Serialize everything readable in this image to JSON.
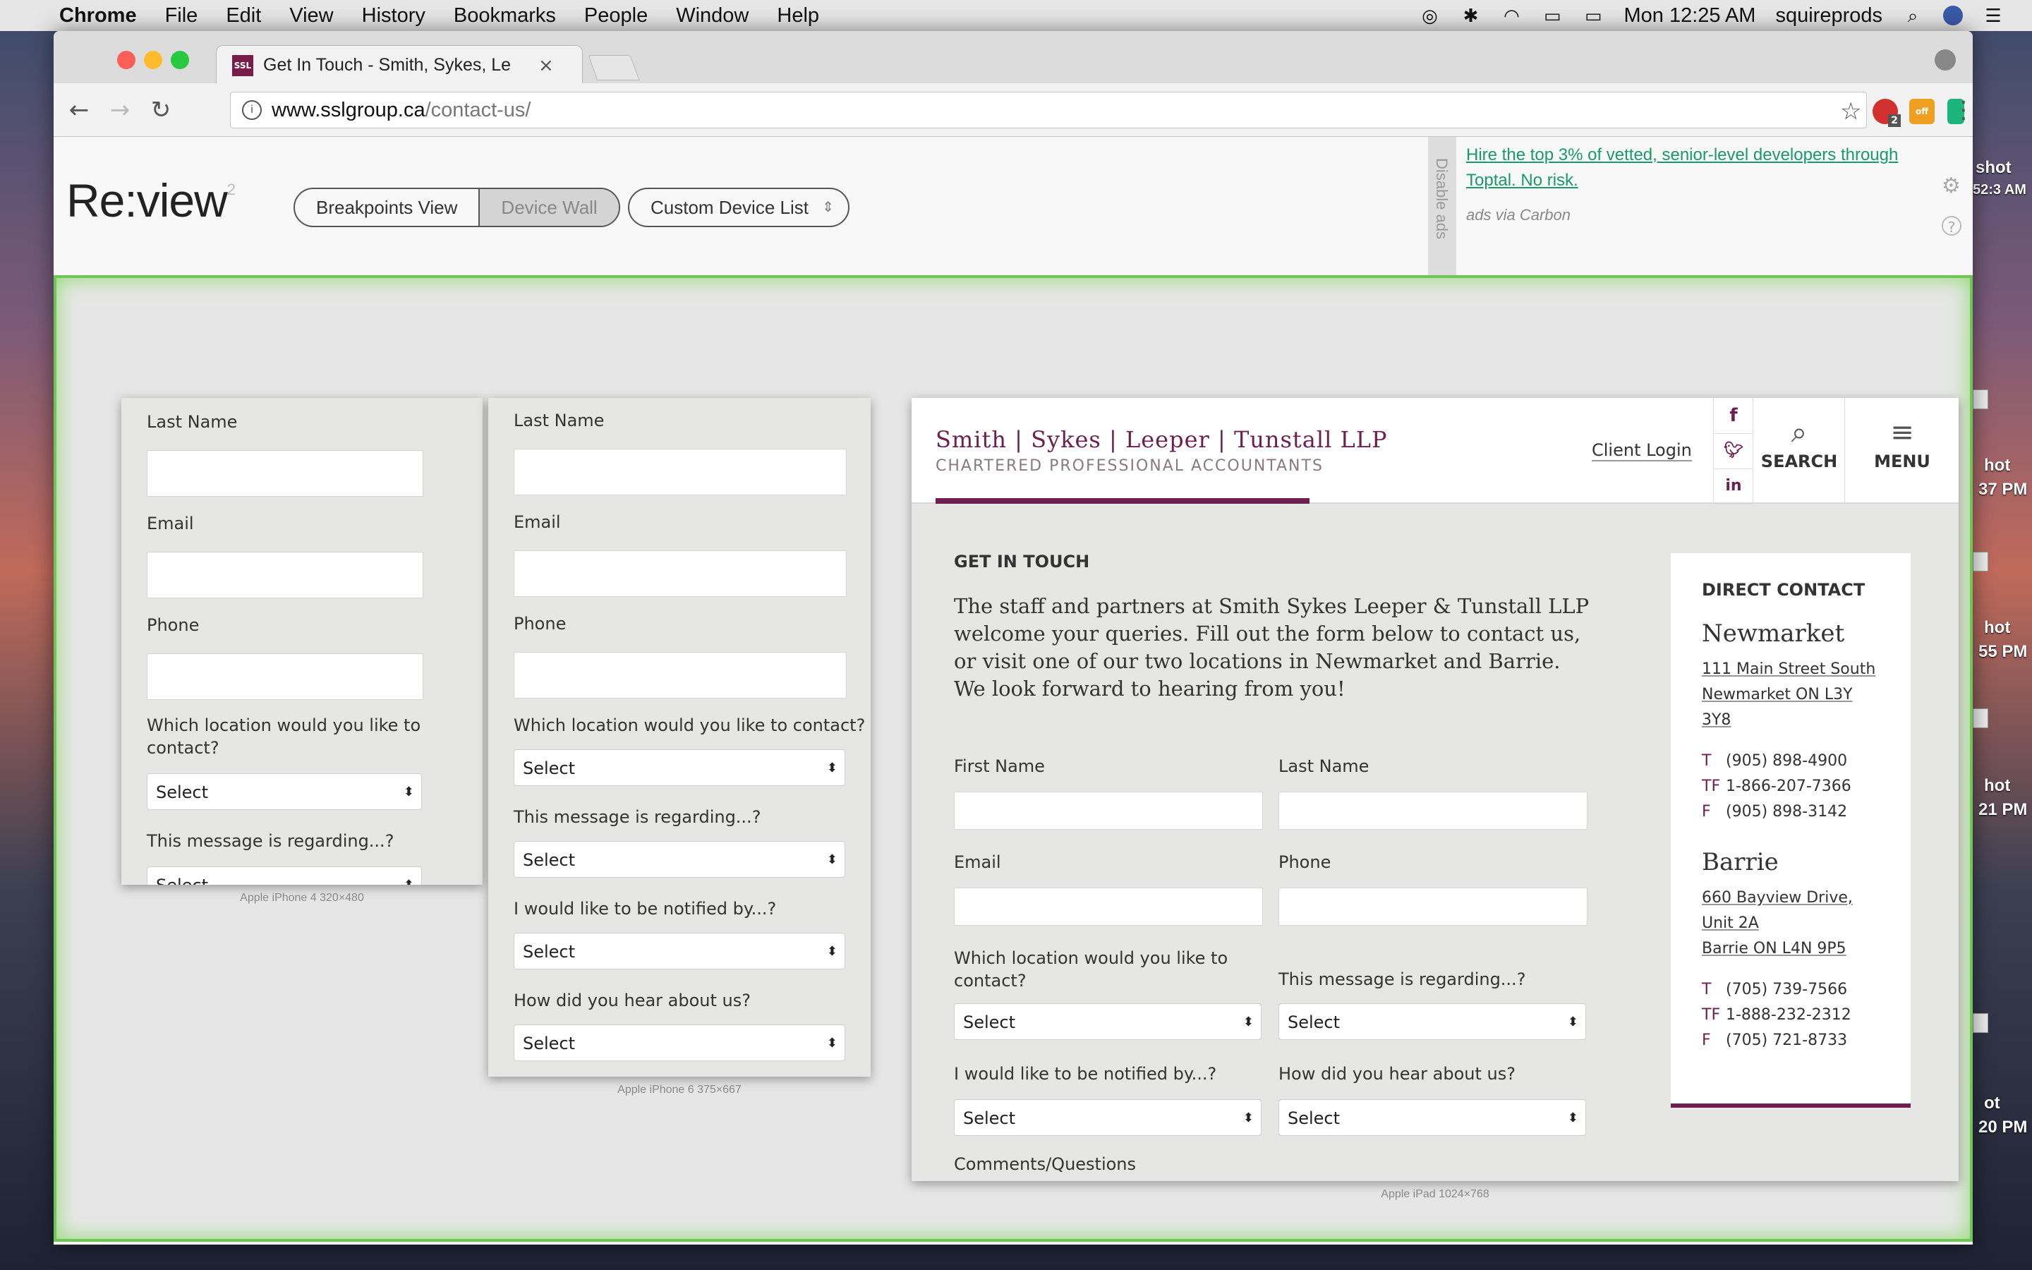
{
  "menubar": {
    "app": "Chrome",
    "items": [
      "File",
      "Edit",
      "View",
      "History",
      "Bookmarks",
      "People",
      "Window",
      "Help"
    ],
    "clock": "Mon 12:25 AM",
    "user": "squireprods"
  },
  "desktop": {
    "labels": [
      "shot",
      "52:3 AM",
      "hot",
      "37 PM",
      "hot",
      "55 PM",
      "hot",
      "21 PM",
      "ot",
      "20 PM"
    ]
  },
  "browser": {
    "tab_title": "Get In Touch - Smith, Sykes, Le",
    "favicon_text": "SSL",
    "url_host": "www.sslgroup.ca",
    "url_path": "/contact-us/",
    "ext_badge": "2",
    "ext_off": "off"
  },
  "review": {
    "logo": "Re:view",
    "logo_sup": "2",
    "breakpoints": "Breakpoints View",
    "devicewall": "Device Wall",
    "custom": "Custom Device List",
    "disable_ads": "Disable ads",
    "ad_text": "Hire the top 3% of vetted, senior-level developers through Toptal. No risk.",
    "ad_via": "ads via Carbon"
  },
  "iphone4": {
    "device_label": "Apple iPhone 4   320×480",
    "last_name": "Last Name",
    "email": "Email",
    "phone": "Phone",
    "location_q": "Which location would you like to contact?",
    "select": "Select",
    "regarding_q": "This message is regarding...?"
  },
  "iphone6": {
    "device_label": "Apple iPhone 6   375×667",
    "last_name": "Last Name",
    "email": "Email",
    "phone": "Phone",
    "location_q": "Which location would you like to contact?",
    "regarding_q": "This message is regarding...?",
    "notified_q": "I would like to be notified by...?",
    "hear_q": "How did you hear about us?",
    "select": "Select"
  },
  "ipad": {
    "device_label": "Apple iPad   1024×768",
    "brand_line1": "Smith | Sykes | Leeper | Tunstall LLP",
    "brand_line2": "CHARTERED PROFESSIONAL ACCOUNTANTS",
    "client_login": "Client Login",
    "social": [
      "f",
      "t",
      "in"
    ],
    "search": "SEARCH",
    "menu": "MENU",
    "heading": "GET IN TOUCH",
    "intro": "The staff and partners at Smith Sykes Leeper & Tunstall LLP welcome your queries. Fill out the form below to contact us, or visit one of our two locations in Newmarket and Barrie. We look forward to hearing from you!",
    "first_name": "First Name",
    "last_name": "Last Name",
    "email": "Email",
    "phone": "Phone",
    "location_q": "Which location would you like to contact?",
    "regarding_q": "This message is regarding...?",
    "notified_q": "I would like to be notified by...?",
    "hear_q": "How did you hear about us?",
    "comments": "Comments/Questions",
    "select": "Select",
    "direct_contact": "DIRECT CONTACT",
    "newmarket": {
      "city": "Newmarket",
      "addr1": "111 Main Street South",
      "addr2": "Newmarket ON L3Y",
      "addr3": "3Y8",
      "t": "(905) 898-4900",
      "tf": "1-866-207-7366",
      "f": "(905) 898-3142"
    },
    "barrie": {
      "city": "Barrie",
      "addr1": "660 Bayview Drive,",
      "addr2": "Unit 2A",
      "addr3": "Barrie ON L4N 9P5",
      "t": "(705) 739-7566",
      "tf": "1-888-232-2312",
      "f": "(705) 721-8733"
    },
    "phone_labels": {
      "t": "T",
      "tf": "TF",
      "f": "F"
    }
  },
  "colors": {
    "brand": "#6b2050",
    "wall_border": "#72c45a",
    "ad_link": "#1a9a6a"
  }
}
